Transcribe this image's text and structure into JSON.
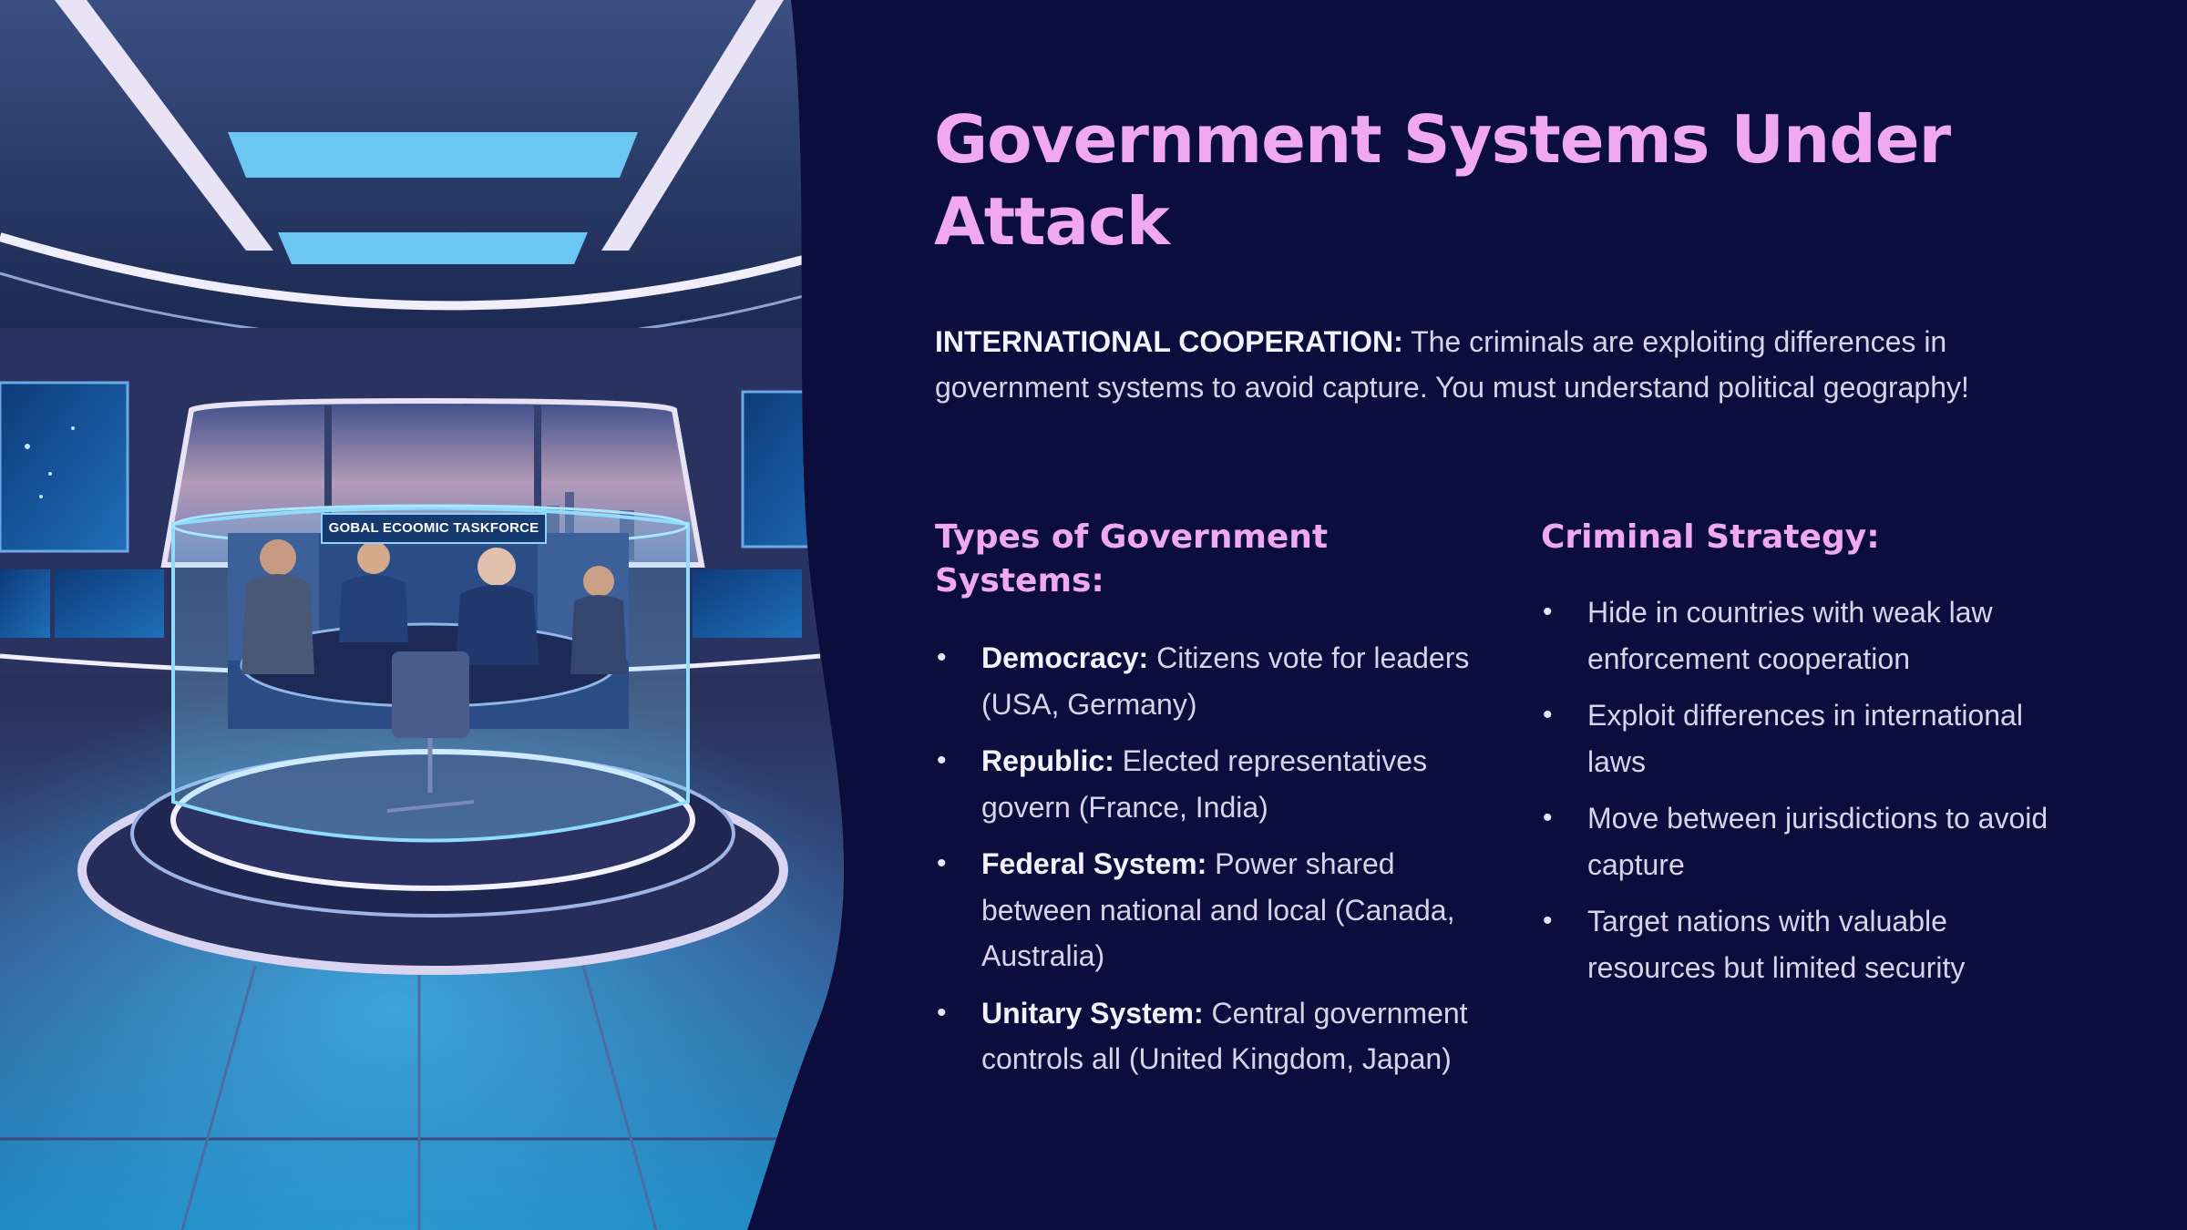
{
  "slide": {
    "title": "Government Systems Under Attack",
    "intro": {
      "lead": "INTERNATIONAL COOPERATION:",
      "text": " The criminals are exploiting differences in government systems to avoid capture. You must understand political geography!"
    },
    "image": {
      "sign_text": "GOBAL ECOOMIC TASKFORCE"
    },
    "left_column": {
      "heading": "Types of Government Systems:",
      "items": [
        {
          "term": "Democracy:",
          "text": " Citizens vote for leaders (USA, Germany)"
        },
        {
          "term": "Republic:",
          "text": " Elected representatives govern (France, India)"
        },
        {
          "term": "Federal System:",
          "text": " Power shared between national and local (Canada, Australia)"
        },
        {
          "term": "Unitary System:",
          "text": " Central government controls all (United Kingdom, Japan)"
        }
      ]
    },
    "right_column": {
      "heading": "Criminal Strategy:",
      "items": [
        {
          "text": "Hide in countries with weak law enforcement cooperation"
        },
        {
          "text": "Exploit differences in international laws"
        },
        {
          "text": "Move between jurisdictions to avoid capture"
        },
        {
          "text": "Target nations with valuable resources but limited security"
        }
      ]
    },
    "bullet_glyph": "•",
    "colors": {
      "background": "#0b0e3d",
      "accent": "#f0a8ef",
      "body_text": "#d6d3ea",
      "glow": "#5ec8f5"
    }
  }
}
